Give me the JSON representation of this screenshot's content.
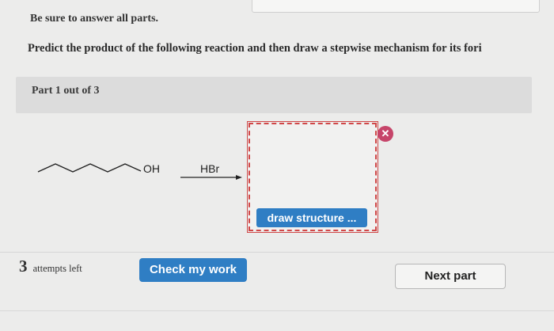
{
  "header": {
    "instruction": "Be sure to answer all parts.",
    "question": "Predict the product of the following reaction and then draw a stepwise mechanism for its fori"
  },
  "part": {
    "label": "Part 1 out of 3"
  },
  "reaction": {
    "reactant_group": "OH",
    "reagent": "HBr"
  },
  "answer_box": {
    "draw_button_label": "draw structure ...",
    "remove_icon": "close-icon",
    "remove_glyph": "✕",
    "border_color": "#d04848"
  },
  "footer": {
    "attempts_count": "3",
    "attempts_text": "attempts left",
    "check_button_label": "Check my work",
    "next_button_label": "Next part"
  },
  "colors": {
    "primary_button": "#2f7ec4",
    "error": "#c6456a"
  }
}
